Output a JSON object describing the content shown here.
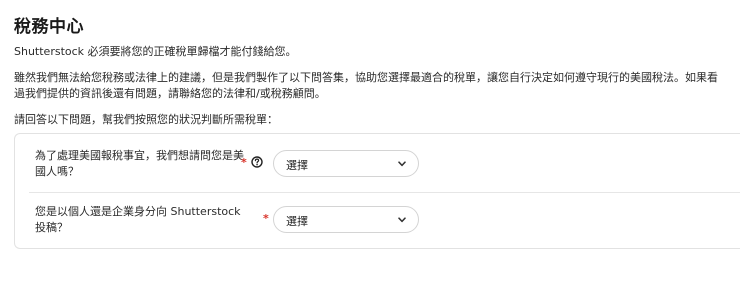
{
  "page": {
    "title": "稅務中心",
    "intro": "Shutterstock 必須要將您的正確稅單歸檔才能付錢給您。",
    "disclaimer_line1": "雖然我們無法給您稅務或法律上的建議，但是我們製作了以下問答集，協助您選擇最適合的稅單，讓您自行決定如何遵守現行的美國稅法。如果看",
    "disclaimer_line2": "過我們提供的資訊後還有問題，請聯絡您的法律和/或稅務顧問。",
    "instructions": "請回答以下問題，幫我們按照您的狀況判斷所需稅單："
  },
  "form": {
    "questions": [
      {
        "label": "為了處理美國報稅事宜，我們想請問您是美國人嗎？",
        "required_mark": "*",
        "has_help_icon": true,
        "select_value": "選擇"
      },
      {
        "label": "您是以個人還是企業身分向 Shutterstock 投稿？",
        "required_mark": "*",
        "has_help_icon": false,
        "select_value": "選擇"
      }
    ]
  },
  "icons": {
    "help": "question-circle-icon",
    "chevron": "chevron-down-icon"
  },
  "colors": {
    "required": "#d9342b",
    "text": "#212121",
    "border": "#d4d4d4"
  }
}
